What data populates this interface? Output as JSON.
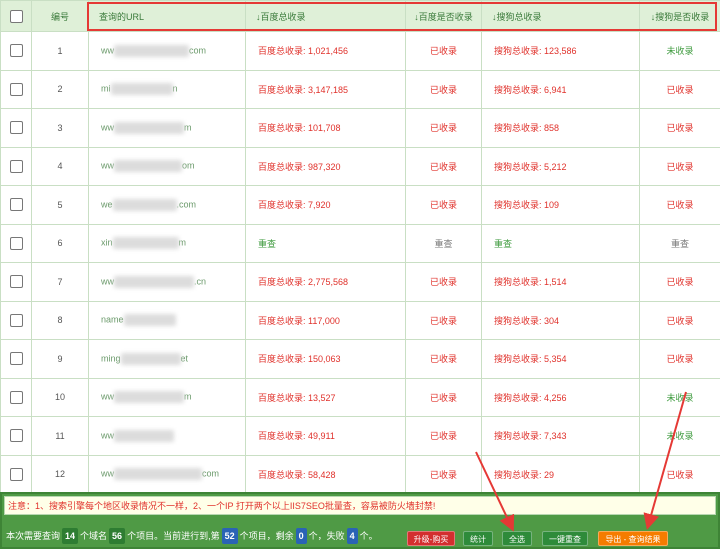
{
  "header": {
    "num": "编号",
    "url": "查询的URL",
    "baidu_total": "↓百度总收录",
    "baidu_status": "↓百度是否收录",
    "sogou_total": "↓搜狗总收录",
    "sogou_status": "↓搜狗是否收录"
  },
  "rows": [
    {
      "num": "1",
      "url_a": "ww",
      "url_b": "com",
      "baidu_total": "百度总收录: 1,021,456",
      "baidu_status": "已收录",
      "sogou_total": "搜狗总收录: 123,586",
      "sogou_status": "未收录"
    },
    {
      "num": "2",
      "url_a": "mi",
      "url_b": "n",
      "baidu_total": "百度总收录: 3,147,185",
      "baidu_status": "已收录",
      "sogou_total": "搜狗总收录: 6,941",
      "sogou_status": "已收录"
    },
    {
      "num": "3",
      "url_a": "ww",
      "url_b": "m",
      "baidu_total": "百度总收录: 101,708",
      "baidu_status": "已收录",
      "sogou_total": "搜狗总收录: 858",
      "sogou_status": "已收录"
    },
    {
      "num": "4",
      "url_a": "ww",
      "url_b": "om",
      "baidu_total": "百度总收录: 987,320",
      "baidu_status": "已收录",
      "sogou_total": "搜狗总收录: 5,212",
      "sogou_status": "已收录"
    },
    {
      "num": "5",
      "url_a": "we",
      "url_b": ".com",
      "baidu_total": "百度总收录: 7,920",
      "baidu_status": "已收录",
      "sogou_total": "搜狗总收录: 109",
      "sogou_status": "已收录"
    },
    {
      "num": "6",
      "url_a": "xin",
      "url_b": "m",
      "baidu_total": "重查",
      "baidu_status": "重查",
      "sogou_total": "重查",
      "sogou_status": "重查"
    },
    {
      "num": "7",
      "url_a": "ww",
      "url_b": ".cn",
      "baidu_total": "百度总收录: 2,775,568",
      "baidu_status": "已收录",
      "sogou_total": "搜狗总收录: 1,514",
      "sogou_status": "已收录"
    },
    {
      "num": "8",
      "url_a": "name",
      "url_b": "",
      "baidu_total": "百度总收录: 117,000",
      "baidu_status": "已收录",
      "sogou_total": "搜狗总收录: 304",
      "sogou_status": "已收录"
    },
    {
      "num": "9",
      "url_a": "ming",
      "url_b": "et",
      "baidu_total": "百度总收录: 150,063",
      "baidu_status": "已收录",
      "sogou_total": "搜狗总收录: 5,354",
      "sogou_status": "已收录"
    },
    {
      "num": "10",
      "url_a": "ww",
      "url_b": "m",
      "baidu_total": "百度总收录: 13,527",
      "baidu_status": "已收录",
      "sogou_total": "搜狗总收录: 4,256",
      "sogou_status": "未收录"
    },
    {
      "num": "11",
      "url_a": "ww",
      "url_b": "",
      "baidu_total": "百度总收录: 49,911",
      "baidu_status": "已收录",
      "sogou_total": "搜狗总收录: 7,343",
      "sogou_status": "未收录"
    },
    {
      "num": "12",
      "url_a": "ww",
      "url_b": "com",
      "baidu_total": "百度总收录: 58,428",
      "baidu_status": "已收录",
      "sogou_total": "搜狗总收录: 29",
      "sogou_status": "已收录"
    }
  ],
  "notice": "注意：1、搜索引擎每个地区收录情况不一样，2、一个IP 打开两个以上IIS7SEO批量查，容易被防火墙封禁!",
  "stats": {
    "t1": "本次需要查询",
    "total": "14",
    "t2": "个域名",
    "items": "56",
    "t3": "个项目。当前进行到,第",
    "current": "52",
    "t4": "个项目，剩余",
    "remaining": "0",
    "t5": "个，失败",
    "failed": "4",
    "t6": "个。"
  },
  "buttons": {
    "upgrade": "升级-购买",
    "stats": "统计",
    "select_all": "全选",
    "requery": "一键重查",
    "export": "导出 - 查询结果"
  },
  "colors": {
    "header_bg": "#dff0d8",
    "panel_bg": "#4f9a45",
    "red": "#e0312b",
    "green": "#3d9a3d",
    "export_btn": "#f57c00",
    "upgrade_btn": "#d32f2f"
  }
}
